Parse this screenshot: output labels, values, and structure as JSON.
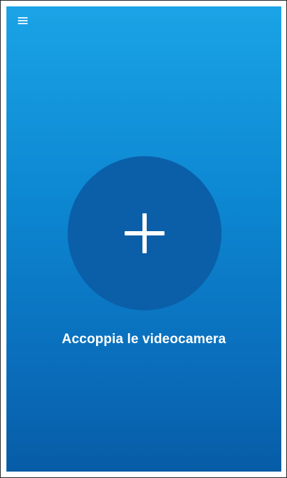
{
  "menu": {
    "icon": "hamburger-menu-icon"
  },
  "pair_camera": {
    "icon": "plus-icon",
    "label": "Accoppia le videocamera"
  },
  "colors": {
    "gradient_top": "#1aa3e6",
    "gradient_bottom": "#075ca6",
    "circle": "#0a5fa8",
    "text": "#ffffff"
  }
}
